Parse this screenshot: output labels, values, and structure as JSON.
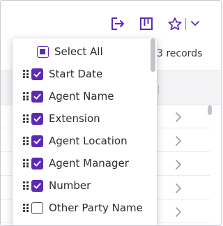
{
  "toolbar": {
    "export_icon": "export-arrow-icon",
    "columns_icon": "columns-icon",
    "favorite_icon": "star-icon",
    "dropdown_icon": "chevron-down-icon"
  },
  "table": {
    "record_count_text": "3 records"
  },
  "column_menu": {
    "select_all": {
      "label": "Select All",
      "state": "partial"
    },
    "items": [
      {
        "label": "Start Date",
        "checked": true
      },
      {
        "label": "Agent Name",
        "checked": true
      },
      {
        "label": "Extension",
        "checked": true
      },
      {
        "label": "Agent Location",
        "checked": true
      },
      {
        "label": "Agent Manager",
        "checked": true
      },
      {
        "label": "Number",
        "checked": true
      },
      {
        "label": "Other Party Name",
        "checked": false
      }
    ]
  },
  "colors": {
    "accent": "#5b2bb5",
    "icon": "#5b2bb5",
    "text": "#2b2b33"
  }
}
